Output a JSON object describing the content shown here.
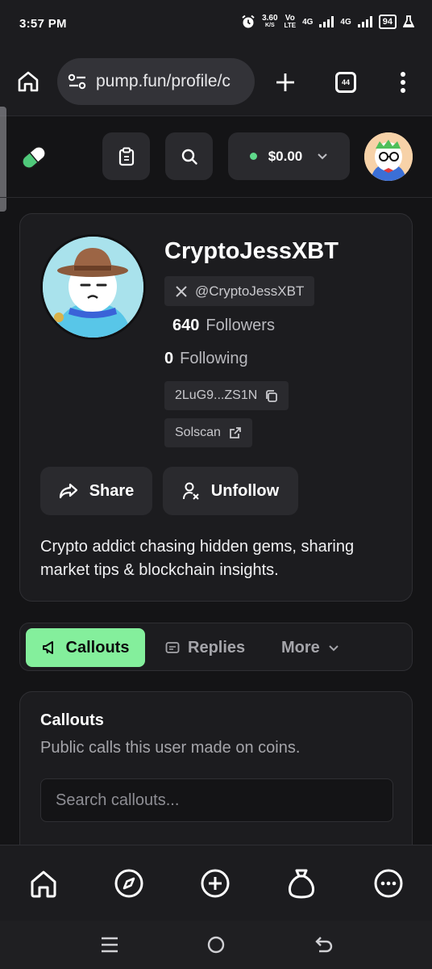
{
  "status": {
    "time": "3:57 PM",
    "net_speed": "3.60",
    "net_unit": "K/S",
    "volte_top": "Vo",
    "volte_bottom": "LTE",
    "gen1": "4G",
    "gen2": "4G",
    "battery": "94"
  },
  "browser": {
    "url": "pump.fun/profile/c",
    "tabs_count": "44"
  },
  "header": {
    "wallet_amount": "$0.00"
  },
  "profile": {
    "username": "CryptoJessXBT",
    "x_handle": "@CryptoJessXBT",
    "followers_count": "640",
    "followers_label": "Followers",
    "following_count": "0",
    "following_label": "Following",
    "address": "2LuG9...ZS1N",
    "explorer_label": "Solscan",
    "share_label": "Share",
    "unfollow_label": "Unfollow",
    "bio": "Crypto addict chasing hidden gems, sharing market tips & blockchain insights."
  },
  "tabs": {
    "items": [
      {
        "label": "Callouts",
        "icon": "megaphone-icon",
        "active": true
      },
      {
        "label": "Replies",
        "icon": "message-icon",
        "active": false
      },
      {
        "label": "More",
        "icon": "chevron-down-icon",
        "active": false
      }
    ]
  },
  "callouts": {
    "title": "Callouts",
    "subtitle": "Public calls this user made on coins.",
    "search_placeholder": "Search callouts..."
  },
  "bottom_nav": {
    "items": [
      "home-icon",
      "compass-icon",
      "create-icon",
      "bag-icon",
      "more-icon"
    ]
  },
  "colors": {
    "background": "#141416",
    "card": "#1c1c1f",
    "accent_green": "#84ef9c",
    "online_dot": "#5fd98b"
  }
}
